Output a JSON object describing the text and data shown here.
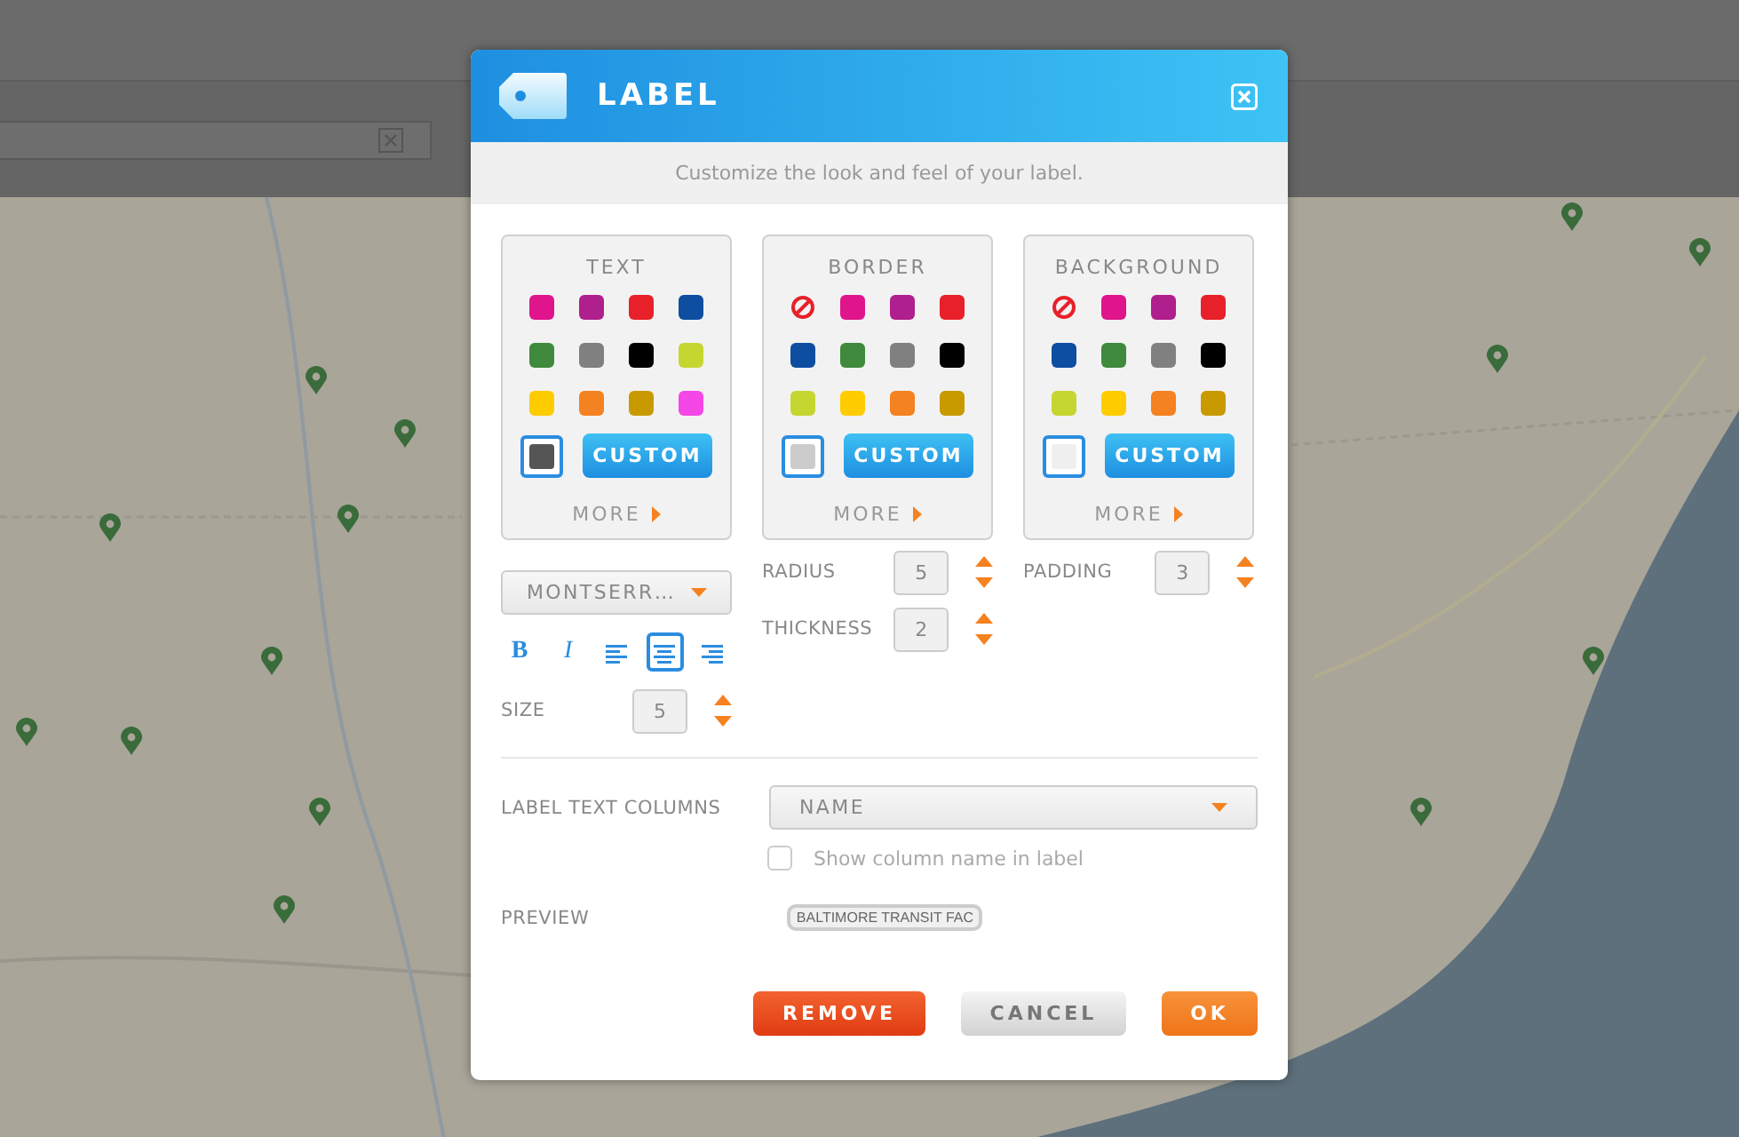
{
  "dialog": {
    "title": "LABEL",
    "subtitle": "Customize the look and feel of your label."
  },
  "palettes": [
    {
      "title": "TEXT",
      "none_option": false,
      "swatches": [
        {
          "color": "#e0158c"
        },
        {
          "color": "#b01f8e"
        },
        {
          "color": "#e8202a"
        },
        {
          "color": "#0d4ea0"
        },
        {
          "color": "#3f8a3c"
        },
        {
          "color": "#808080"
        },
        {
          "color": "#000000"
        },
        {
          "color": "#c6d630"
        },
        {
          "color": "#ffcc00"
        },
        {
          "color": "#f58220"
        },
        {
          "color": "#c99a00"
        },
        {
          "color": "#f546e6"
        }
      ],
      "current": {
        "color": "#555555"
      },
      "custom_label": "CUSTOM",
      "more_label": "MORE"
    },
    {
      "title": "BORDER",
      "none_option": true,
      "swatches": [
        {
          "color": "#e0158c"
        },
        {
          "color": "#b01f8e"
        },
        {
          "color": "#e8202a"
        },
        {
          "color": "#0d4ea0"
        },
        {
          "color": "#3f8a3c"
        },
        {
          "color": "#808080"
        },
        {
          "color": "#000000"
        },
        {
          "color": "#c6d630"
        },
        {
          "color": "#ffcc00"
        },
        {
          "color": "#f58220"
        },
        {
          "color": "#c99a00"
        }
      ],
      "current": {
        "color": "#cccccc"
      },
      "custom_label": "CUSTOM",
      "more_label": "MORE"
    },
    {
      "title": "BACKGROUND",
      "none_option": true,
      "swatches": [
        {
          "color": "#e0158c"
        },
        {
          "color": "#b01f8e"
        },
        {
          "color": "#e8202a"
        },
        {
          "color": "#0d4ea0"
        },
        {
          "color": "#3f8a3c"
        },
        {
          "color": "#808080"
        },
        {
          "color": "#000000"
        },
        {
          "color": "#c6d630"
        },
        {
          "color": "#ffcc00"
        },
        {
          "color": "#f58220"
        },
        {
          "color": "#c99a00"
        }
      ],
      "current": {
        "color": "#f0f0f0"
      },
      "custom_label": "CUSTOM",
      "more_label": "MORE"
    }
  ],
  "font": {
    "value": "MONTSERR…"
  },
  "format_buttons": [
    {
      "kind": "bold",
      "label": "B",
      "selected": false
    },
    {
      "kind": "italic",
      "label": "I",
      "selected": false
    },
    {
      "kind": "align-left",
      "selected": false
    },
    {
      "kind": "align-center",
      "selected": true
    },
    {
      "kind": "align-right",
      "selected": false
    }
  ],
  "size": {
    "label": "SIZE",
    "value": "5"
  },
  "radius": {
    "label": "RADIUS",
    "value": "5"
  },
  "thickness": {
    "label": "THICKNESS",
    "value": "2"
  },
  "padding": {
    "label": "PADDING",
    "value": "3"
  },
  "label_columns": {
    "label": "LABEL TEXT COLUMNS",
    "value": "NAME"
  },
  "show_column_name": {
    "label": "Show column name in label",
    "checked": false
  },
  "preview": {
    "label": "PREVIEW",
    "text": "BALTIMORE TRANSIT FAC"
  },
  "buttons": [
    {
      "kind": "danger",
      "label": "REMOVE"
    },
    {
      "kind": "secondary",
      "label": "CANCEL"
    },
    {
      "kind": "primary",
      "label": "OK"
    }
  ]
}
